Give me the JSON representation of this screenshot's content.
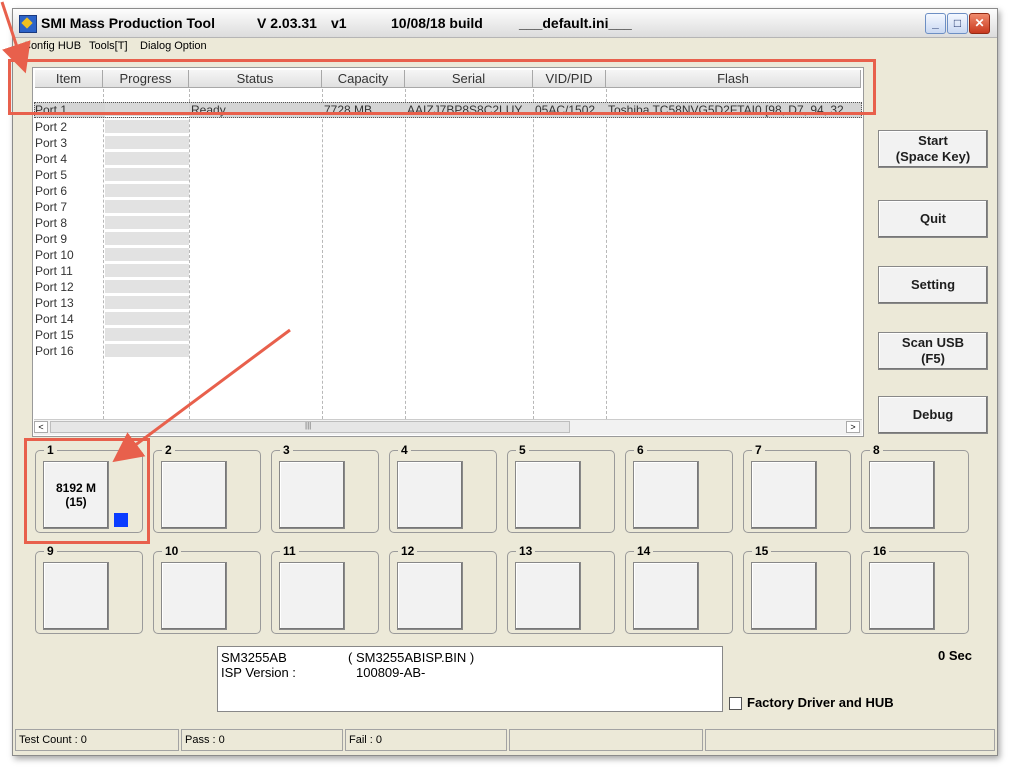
{
  "window": {
    "app_name": "SMI Mass Production Tool",
    "version": "V 2.03.31",
    "build_tag": "v1",
    "build_date": "10/08/18 build",
    "ini_file": "___default.ini___"
  },
  "menu": [
    "Config HUB",
    "Tools[T]",
    "Dialog Option"
  ],
  "table": {
    "columns": [
      "Item",
      "Progress",
      "Status",
      "Capacity",
      "Serial",
      "VID/PID",
      "Flash"
    ],
    "ports": [
      "Port 1",
      "Port 2",
      "Port 3",
      "Port 4",
      "Port 5",
      "Port 6",
      "Port 7",
      "Port 8",
      "Port 9",
      "Port 10",
      "Port 11",
      "Port 12",
      "Port 13",
      "Port 14",
      "Port 15",
      "Port 16"
    ],
    "row1": {
      "item": "Port 1",
      "status": "Ready",
      "capacity": "7728 MB",
      "serial": "AAIZJ7BP8S8C2LUY",
      "vidpid": "05AC/1502",
      "flash": "Toshiba TC58NVG5D2FTAI0 [98, D7, 94, 32"
    },
    "scroll_mark": "|||"
  },
  "buttons": {
    "start": "Start\n(Space Key)",
    "quit": "Quit",
    "setting": "Setting",
    "scan_usb": "Scan USB\n(F5)",
    "debug": "Debug"
  },
  "slots": {
    "numbers": [
      "1",
      "2",
      "3",
      "4",
      "5",
      "6",
      "7",
      "8",
      "9",
      "10",
      "11",
      "12",
      "13",
      "14",
      "15",
      "16"
    ],
    "slot1_capacity": "8192 M",
    "slot1_count": "(15)",
    "slot1_indicator_color": "#0a3cff"
  },
  "info": {
    "controller": "SM3255AB",
    "isp_file": "( SM3255ABISP.BIN )",
    "isp_label": "ISP Version :",
    "isp_version": "100809-AB-"
  },
  "timer": "0 Sec",
  "factory_checkbox": {
    "label": "Factory Driver and HUB",
    "checked": false
  },
  "statusbar": {
    "test_count": "Test Count : 0",
    "pass": "Pass : 0",
    "fail": "Fail : 0"
  },
  "colors": {
    "annotation": "#e8604c",
    "window_bg": "#ece9d8"
  }
}
